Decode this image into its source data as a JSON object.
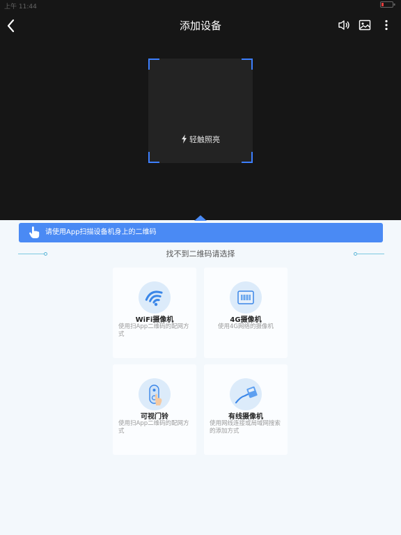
{
  "status_bar": {
    "time": "上午 11:44",
    "battery": ""
  },
  "header": {
    "title": "添加设备",
    "back_icon": "chevron-left-icon",
    "sound_icon": "speaker-icon",
    "gallery_icon": "image-icon",
    "more_icon": "more-vertical-icon"
  },
  "scanner": {
    "torch_label": "轻触照亮",
    "frame_color": "#3d7fff"
  },
  "banner": {
    "text": "请使用App扫描设备机身上的二维码",
    "color": "#4a8af4"
  },
  "hint": {
    "text": "找不到二维码请选择"
  },
  "cards": [
    {
      "title": "WiFi摄像机",
      "desc": "使用扫App二维码的配网方式",
      "icon": "wifi-icon"
    },
    {
      "title": "4G摄像机",
      "desc": "使用4G网络的摄像机",
      "icon": "sim-card-icon"
    },
    {
      "title": "可视门铃",
      "desc": "使用扫App二维码的配网方式",
      "icon": "doorbell-icon"
    },
    {
      "title": "有线摄像机",
      "desc": "使用网线连接或局域网搜索的添加方式",
      "icon": "ethernet-cable-icon"
    }
  ]
}
